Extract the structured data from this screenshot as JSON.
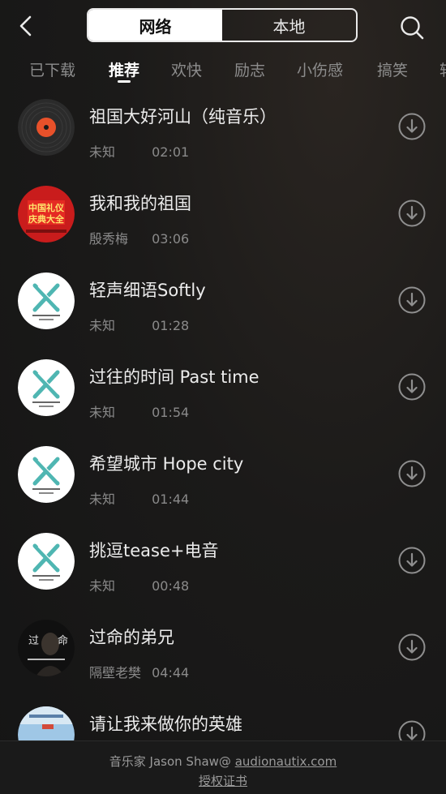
{
  "header": {
    "segment": {
      "network_label": "网络",
      "local_label": "本地",
      "selected": "network"
    }
  },
  "tabs": [
    {
      "label": "已下载",
      "active": false
    },
    {
      "label": "推荐",
      "active": true
    },
    {
      "label": "欢快",
      "active": false
    },
    {
      "label": "励志",
      "active": false
    },
    {
      "label": "小伤感",
      "active": false
    },
    {
      "label": "搞笑",
      "active": false
    },
    {
      "label": "轻",
      "active": false
    }
  ],
  "songs": [
    {
      "title": "祖国大好河山（纯音乐）",
      "artist": "未知",
      "duration": "02:01",
      "cover": "vinyl-record"
    },
    {
      "title": "我和我的祖国",
      "artist": "殷秀梅",
      "duration": "03:06",
      "cover": "album-red-ceremony",
      "cover_text": [
        "中国礼仪",
        "庆典大全"
      ]
    },
    {
      "title": "轻声细语Softly",
      "artist": "未知",
      "duration": "01:28",
      "cover": "x-logo"
    },
    {
      "title": "过往的时间 Past time",
      "artist": "未知",
      "duration": "01:54",
      "cover": "x-logo"
    },
    {
      "title": "希望城市 Hope city",
      "artist": "未知",
      "duration": "01:44",
      "cover": "x-logo"
    },
    {
      "title": "挑逗tease+电音",
      "artist": "未知",
      "duration": "00:48",
      "cover": "x-logo"
    },
    {
      "title": "过命的弟兄",
      "artist": "隔壁老樊",
      "duration": "04:44",
      "cover": "portrait-dark",
      "cover_text": [
        "过",
        "命"
      ]
    },
    {
      "title": "请让我来做你的英雄",
      "artist": "",
      "duration": "",
      "cover": "illustration-light"
    }
  ],
  "footer": {
    "credit_prefix": "音乐家 Jason Shaw@ ",
    "credit_link": "audionautix.com",
    "license_label": "授权证书"
  },
  "colors": {
    "background": "#1b1a19",
    "accent_orange": "#e8512a",
    "logo_teal": "#4fb6b2"
  }
}
